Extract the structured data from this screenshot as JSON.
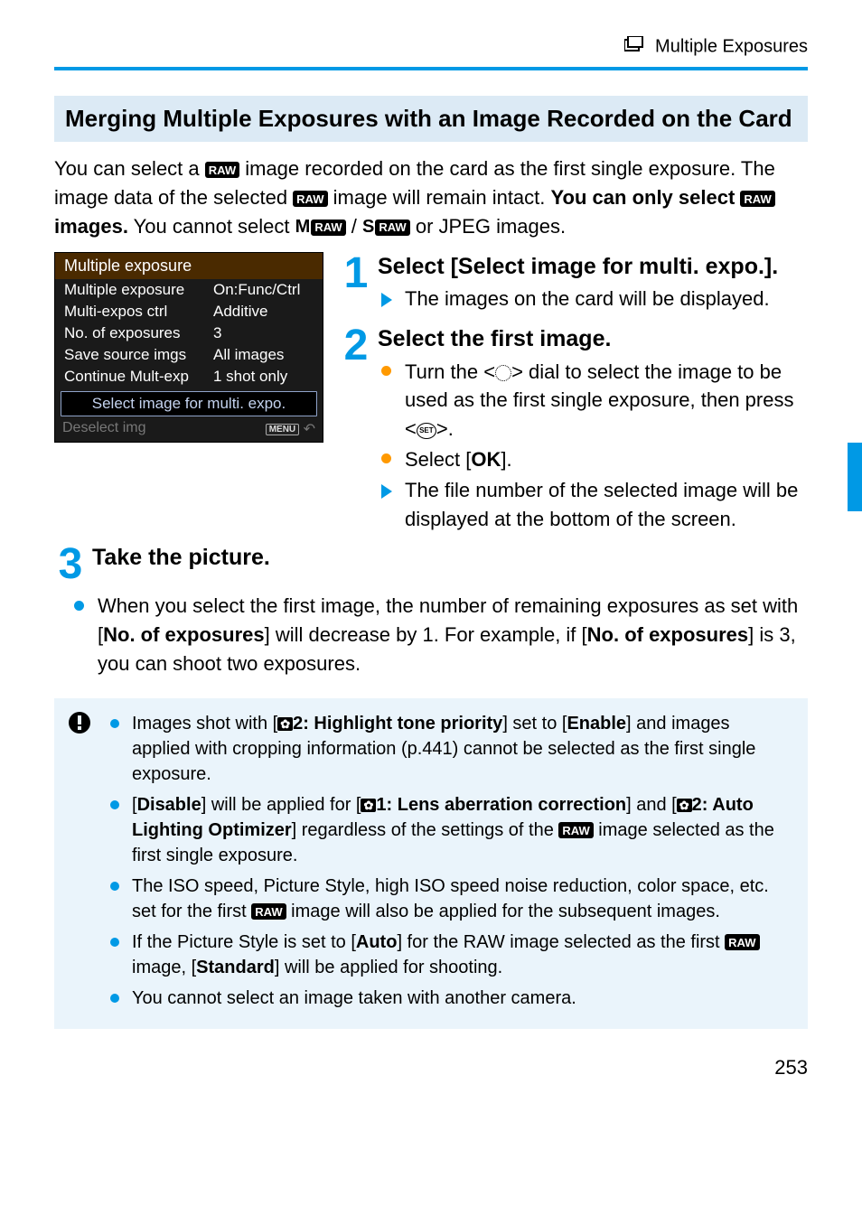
{
  "header": {
    "title": "Multiple Exposures"
  },
  "section_title": "Merging Multiple Exposures with an Image Recorded on the Card",
  "raw_label": "RAW",
  "intro": {
    "p1a": "You can select a ",
    "p1b": " image recorded on the card as the first single exposure. The image data of the selected ",
    "p1c": " image will remain intact. ",
    "p2a": "You can only select ",
    "p2b": " images.",
    "p2c": " You cannot select ",
    "p2d": " or JPEG images.",
    "prefix_m": "M",
    "prefix_s": "S"
  },
  "menu": {
    "title": "Multiple exposure",
    "rows": [
      {
        "label": "Multiple exposure",
        "val": "On:Func/Ctrl"
      },
      {
        "label": "Multi-expos ctrl",
        "val": "Additive"
      },
      {
        "label": "No. of exposures",
        "val": "3"
      },
      {
        "label": "Save source imgs",
        "val": "All images"
      },
      {
        "label": "Continue Mult-exp",
        "val": "1 shot only"
      }
    ],
    "select_row": "Select image for multi. expo.",
    "deselect": "Deselect img",
    "menu_btn": "MENU",
    "back_arrow": "↶"
  },
  "steps": {
    "s1": {
      "num": "1",
      "title": "Select [Select image for multi. expo.].",
      "body": "The images on the card will be displayed."
    },
    "s2": {
      "num": "2",
      "title": "Select the first image.",
      "b1a": "Turn the <",
      "b1b": "> dial to select the image to be used as the first single exposure, then press <",
      "b1c": ">.",
      "b2a": "Select [",
      "b2b": "OK",
      "b2c": "].",
      "b3": "The file number of the selected image will be displayed at the bottom of the screen."
    },
    "s3": {
      "num": "3",
      "title": "Take the picture.",
      "body_a": "When you select the first image, the number of remaining exposures as set with [",
      "body_b": "No. of exposures",
      "body_c": "] will decrease by 1. For example, if [",
      "body_d": "No. of exposures",
      "body_e": "] is 3, you can shoot two exposures."
    }
  },
  "notes": {
    "n1": {
      "a": "Images shot with [",
      "cam": "📷",
      "mid": "2: Highlight tone priority",
      "b": "] set to [",
      "c": "Enable",
      "d": "] and images applied with cropping information (p.441) cannot be selected as the first single exposure."
    },
    "n2": {
      "a": "[",
      "dis": "Disable",
      "b": "] will be applied for [",
      "m1": "1: Lens aberration correction",
      "c": "] and [",
      "m2": "2: Auto Lighting Optimizer",
      "d": "] regardless of the settings of the ",
      "e": " image selected as the first single exposure."
    },
    "n3": {
      "a": "The ISO speed, Picture Style, high ISO speed noise reduction, color space, etc. set for the first ",
      "b": " image will also be applied for the subsequent images."
    },
    "n4": {
      "a": "If the Picture Style is set to [",
      "auto": "Auto",
      "b": "] for the RAW image selected as the first ",
      "c": " image, [",
      "std": "Standard",
      "d": "] will be applied for shooting."
    },
    "n5": "You cannot select an image taken with another camera."
  },
  "page": "253"
}
